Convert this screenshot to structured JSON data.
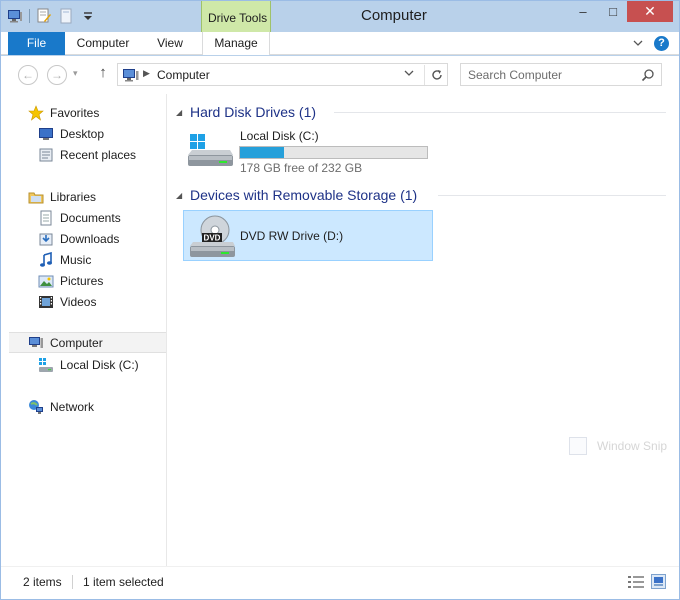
{
  "window": {
    "title": "Computer",
    "contextual_group": "Drive Tools",
    "controls": {
      "minimize": "–",
      "maximize": "□",
      "close": "✕"
    }
  },
  "ribbon": {
    "tabs": [
      {
        "label": "File"
      },
      {
        "label": "Computer"
      },
      {
        "label": "View"
      },
      {
        "label": "Manage"
      }
    ],
    "help": "?"
  },
  "address": {
    "path": "Computer",
    "search_placeholder": "Search Computer"
  },
  "nav_pane": {
    "favorites": "Favorites",
    "favorites_items": [
      "Desktop",
      "Recent places"
    ],
    "libraries": "Libraries",
    "libraries_items": [
      "Documents",
      "Downloads",
      "Music",
      "Pictures",
      "Videos"
    ],
    "computer": "Computer",
    "computer_items": [
      "Local Disk (C:)"
    ],
    "network": "Network"
  },
  "groups": {
    "hard_disks": {
      "title": "Hard Disk Drives (1)",
      "drive": {
        "name": "Local Disk (C:)",
        "free_text": "178 GB free of 232 GB",
        "used_fraction": 0.233
      }
    },
    "removable": {
      "title": "Devices with Removable Storage (1)",
      "drive": {
        "name": "DVD RW Drive (D:)",
        "badge": "DVD",
        "selected": true
      }
    }
  },
  "overlay": {
    "ghost_text": "Window Snip"
  },
  "status": {
    "item_count": "2 items",
    "selected": "1 item selected"
  },
  "colors": {
    "accent": "#1979ca",
    "selection": "#cce8ff",
    "progress": "#26a0da",
    "group_title": "#1e3287",
    "context_tab": "#cfe8a8"
  }
}
